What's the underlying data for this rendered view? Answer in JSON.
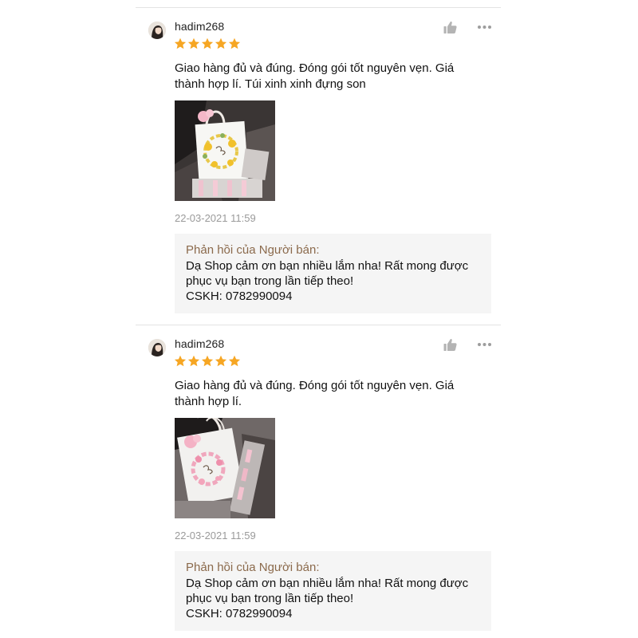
{
  "reviews": [
    {
      "username": "hadim268",
      "rating": 5,
      "rating_max": 5,
      "comment": "Giao hàng đủ và đúng. Đóng gói tốt nguyên vẹn. Giá thành hợp lí. Túi xinh xinh đựng son",
      "photo_wreath": "sunflower",
      "timestamp": "22-03-2021 11:59",
      "seller_reply": {
        "title": "Phản hồi của Người bán:",
        "lines": [
          "Dạ Shop cảm ơn bạn nhiều lắm nha! Rất mong được",
          "phục vụ bạn trong lần tiếp theo!",
          "CSKH: 0782990094"
        ]
      }
    },
    {
      "username": "hadim268",
      "rating": 5,
      "rating_max": 5,
      "comment": "Giao hàng đủ và đúng. Đóng gói tốt nguyên vẹn. Giá thành hợp lí.",
      "photo_wreath": "pink-floral",
      "timestamp": "22-03-2021 11:59",
      "seller_reply": {
        "title": "Phản hồi của Người bán:",
        "lines": [
          "Dạ Shop cảm ơn bạn nhiều lắm nha! Rất mong được",
          "phục vụ bạn trong lần tiếp theo!",
          "CSKH: 0782990094"
        ]
      }
    }
  ],
  "icons": {
    "like": "thumbs-up-icon",
    "more": "more-options-icon",
    "star": "star-icon"
  },
  "colors": {
    "star": "#f6a623",
    "seller_reply_title": "#8b6a4c",
    "timestamp": "#9a9a9a",
    "reply_background": "#f5f5f5"
  }
}
